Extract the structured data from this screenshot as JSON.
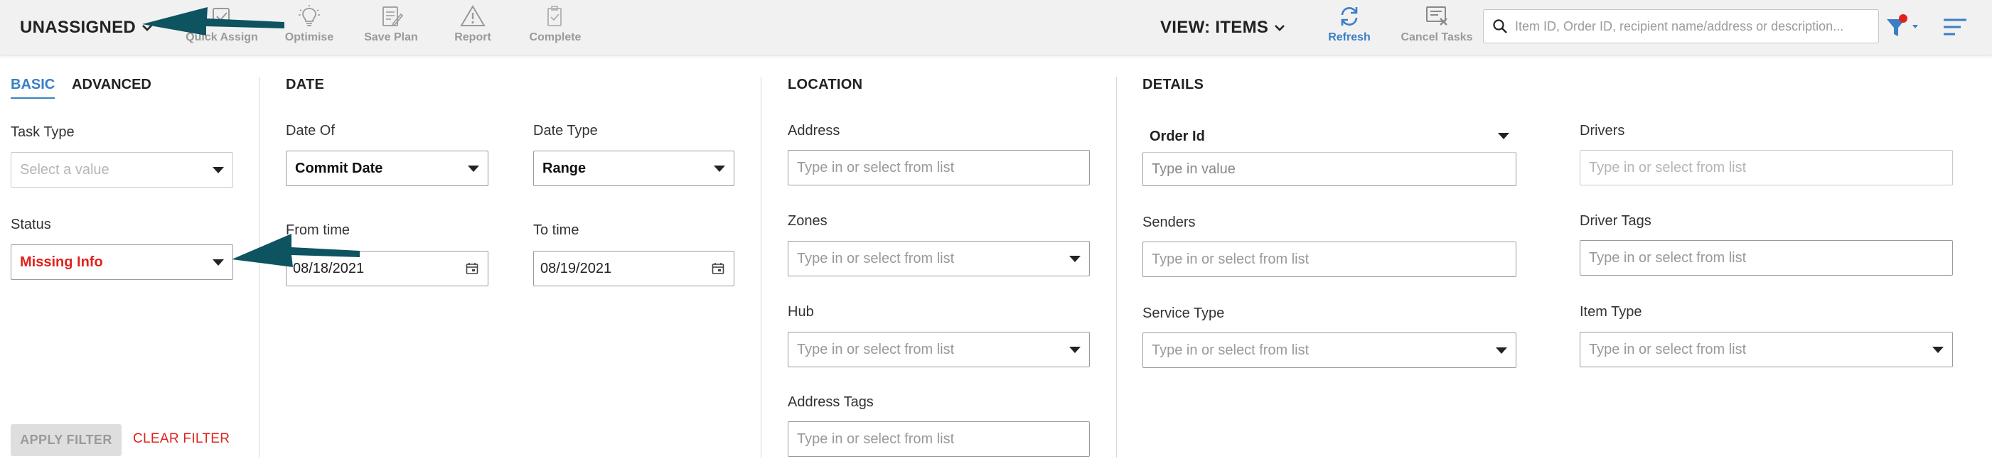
{
  "toolbar": {
    "view_label": "UNASSIGNED",
    "tools": [
      {
        "label": "Quick Assign",
        "icon": "quick-assign-icon"
      },
      {
        "label": "Optimise",
        "icon": "lightbulb-icon"
      },
      {
        "label": "Save Plan",
        "icon": "save-plan-icon"
      },
      {
        "label": "Report",
        "icon": "warning-icon"
      },
      {
        "label": "Complete",
        "icon": "complete-icon"
      }
    ],
    "view_items_label": "VIEW: ITEMS",
    "refresh_label": "Refresh",
    "cancel_tasks_label": "Cancel Tasks",
    "search_placeholder": "Item ID, Order ID, recipient name/address or description...",
    "accent_color": "#3a7fc4",
    "filter_dot_color": "#e0221b"
  },
  "basic_panel": {
    "tabs": {
      "basic": "BASIC",
      "advanced": "ADVANCED"
    },
    "task_type": {
      "label": "Task Type",
      "placeholder": "Select a value"
    },
    "status": {
      "label": "Status",
      "value": "Missing Info",
      "value_color": "#e0221b"
    },
    "apply_label": "APPLY FILTER",
    "clear_label": "CLEAR FILTER"
  },
  "date_panel": {
    "title": "DATE",
    "date_of": {
      "label": "Date Of",
      "value": "Commit Date"
    },
    "date_type": {
      "label": "Date Type",
      "value": "Range"
    },
    "from_time": {
      "label": "From time",
      "value": "08/18/2021"
    },
    "to_time": {
      "label": "To time",
      "value": "08/19/2021"
    }
  },
  "location_panel": {
    "title": "LOCATION",
    "address": {
      "label": "Address",
      "placeholder": "Type in or select from list"
    },
    "zones": {
      "label": "Zones",
      "placeholder": "Type in or select from list"
    },
    "hub": {
      "label": "Hub",
      "placeholder": "Type in or select from list"
    },
    "address_tags": {
      "label": "Address Tags",
      "placeholder": "Type in or select from list"
    }
  },
  "details_panel": {
    "title": "DETAILS",
    "order_id": {
      "label": "Order Id",
      "placeholder": "Type in value"
    },
    "senders": {
      "label": "Senders",
      "placeholder": "Type in or select from list"
    },
    "service_type": {
      "label": "Service Type",
      "placeholder": "Type in or select from list"
    },
    "drivers": {
      "label": "Drivers",
      "placeholder": "Type in or select from list"
    },
    "driver_tags": {
      "label": "Driver Tags",
      "placeholder": "Type in or select from list"
    },
    "item_type": {
      "label": "Item Type",
      "placeholder": "Type in or select from list"
    }
  },
  "annotation_color": "#0d5360"
}
